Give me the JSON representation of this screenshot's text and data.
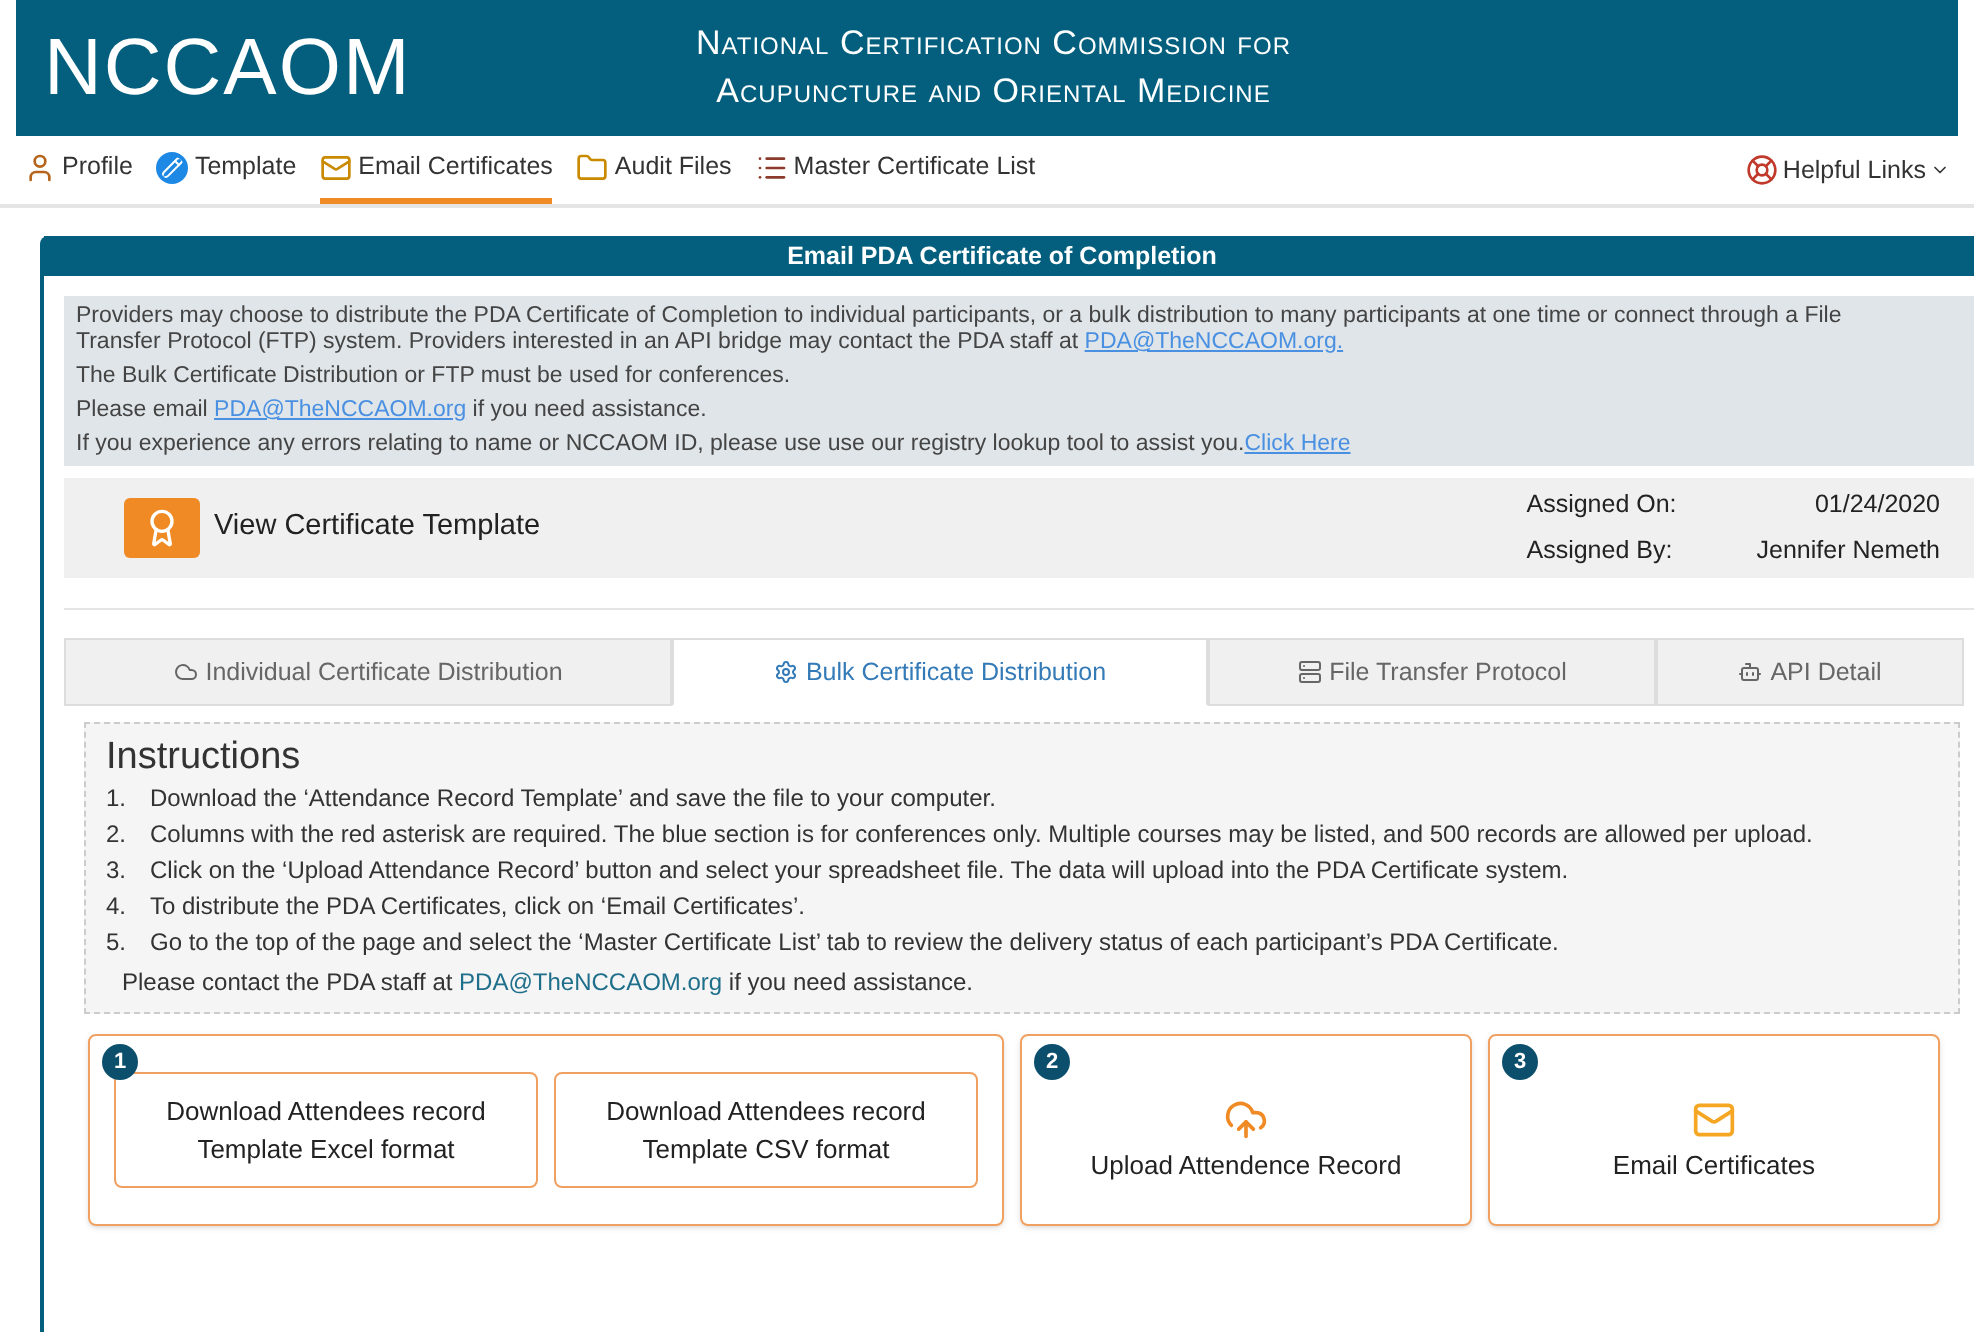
{
  "header": {
    "logo": "NCCAOM",
    "title_lines": [
      "National Certification Commission for",
      "Acupuncture and Oriental Medicine"
    ]
  },
  "nav": {
    "items": [
      {
        "label": "Profile",
        "selected": false
      },
      {
        "label": "Template",
        "selected": false
      },
      {
        "label": "Email Certificates",
        "selected": true
      },
      {
        "label": "Audit Files",
        "selected": false
      },
      {
        "label": "Master Certificate List",
        "selected": false
      }
    ],
    "helpful_links": "Helpful Links"
  },
  "panel": {
    "title": "Email PDA Certificate of Completion",
    "info": [
      {
        "before": "Providers may choose to distribute the PDA Certificate of Completion to individual participants, or a bulk distribution to many participants at one time or connect through a File Transfer Protocol (FTP) system. Providers interested in an API bridge may contact the PDA staff at ",
        "link": "PDA@TheNCCAOM.org."
      },
      {
        "before": "The Bulk Certificate Distribution or FTP must be used for conferences."
      },
      {
        "before": "Please email ",
        "link": "PDA@TheNCCAOM.org",
        "after": " if you need assistance."
      },
      {
        "before": "If you experience any errors relating to name or NCCAOM ID, please use use our registry lookup tool to assist you.",
        "link": "Click Here"
      }
    ],
    "template": {
      "label": "View Certificate Template",
      "assigned_on_label": "Assigned On:",
      "assigned_on": "01/24/2020",
      "assigned_by_label": "Assigned By:",
      "assigned_by": "Jennifer Nemeth"
    },
    "tabs": [
      {
        "label": "Individual Certificate Distribution",
        "selected": false
      },
      {
        "label": "Bulk Certificate Distribution",
        "selected": true
      },
      {
        "label": "File Transfer Protocol",
        "selected": false
      },
      {
        "label": "API Detail",
        "selected": false
      }
    ],
    "instructions": {
      "heading": "Instructions",
      "steps": [
        {
          "number": "1.",
          "text": "Download the ‘Attendance Record Template’ and save the file to your computer."
        },
        {
          "number": "2.",
          "text": "Columns with the red asterisk are required. The blue section is for conferences only. Multiple courses may be listed, and 500 records are allowed per upload."
        },
        {
          "number": "3.",
          "text": "Click on the ‘Upload Attendance Record’ button and select your spreadsheet file. The data will upload into the PDA Certificate system."
        },
        {
          "number": "4.",
          "text": "To distribute the PDA Certificates, click on ‘Email Certificates’."
        },
        {
          "number": "5.",
          "text": "Go to the top of the page and select the ‘Master Certificate List’ tab to review the delivery status of each participant’s PDA Certificate."
        }
      ],
      "contact": {
        "before": "Please contact the PDA staff at ",
        "link": "PDA@TheNCCAOM.org",
        "after": " if you need assistance."
      }
    },
    "steps": [
      {
        "number": "1",
        "kind": "downloads",
        "buttons": [
          "Download Attendees record Template Excel format",
          "Download Attendees record Template CSV format"
        ]
      },
      {
        "number": "2",
        "kind": "upload",
        "label": "Upload Attendence Record"
      },
      {
        "number": "3",
        "kind": "email",
        "label": "Email Certificates"
      }
    ]
  }
}
